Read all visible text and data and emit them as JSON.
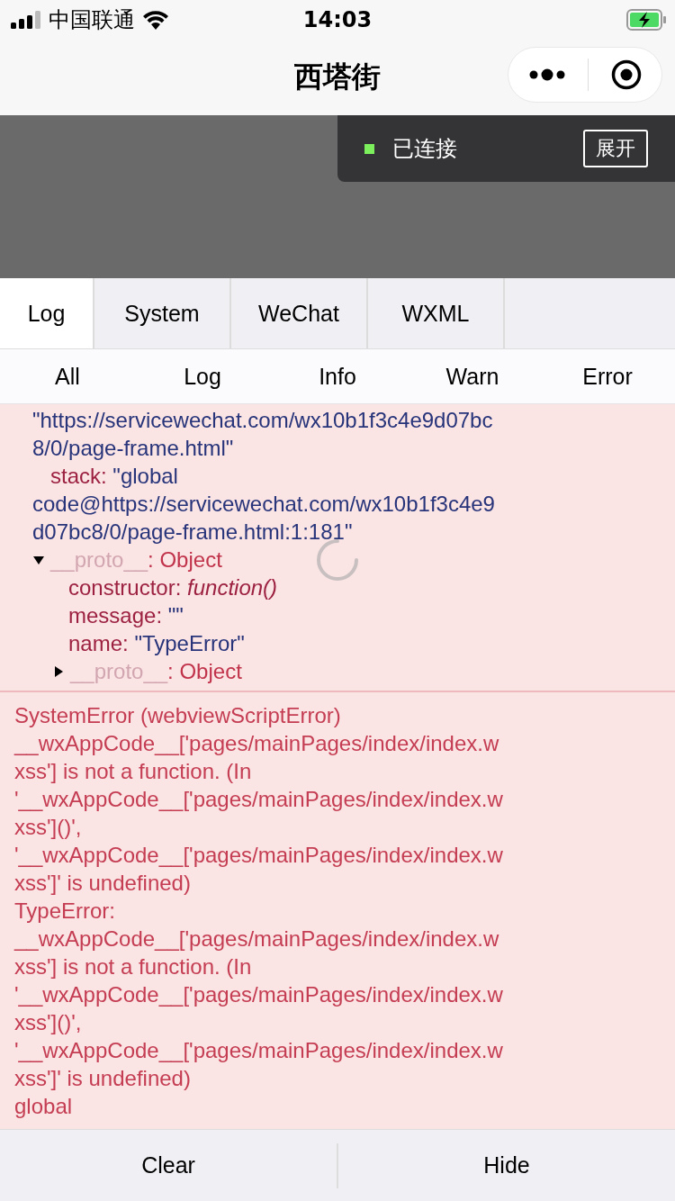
{
  "status_bar": {
    "carrier": "中国联通",
    "time": "14:03"
  },
  "nav": {
    "title": "西塔街"
  },
  "connection": {
    "status": "已连接",
    "connected": true,
    "button": "展开"
  },
  "tabs": [
    {
      "label": "Log",
      "selected": true
    },
    {
      "label": "System",
      "selected": false
    },
    {
      "label": "WeChat",
      "selected": false
    },
    {
      "label": "WXML",
      "selected": false
    }
  ],
  "filters": [
    "All",
    "Log",
    "Info",
    "Warn",
    "Error"
  ],
  "log": [
    {
      "kind": "object",
      "rows": [
        {
          "kind": "text",
          "lines": [
            "\"https://servicewechat.com/wx10b1f3c4e9d07bc",
            "8/0/page-frame.html\""
          ]
        },
        {
          "kind": "prop",
          "key": "stack:",
          "value": "\"global",
          "more": [
            "code@https://servicewechat.com/wx10b1f3c4e9",
            "d07bc8/0/page-frame.html:1:181\""
          ]
        },
        {
          "kind": "node",
          "key": "__proto__",
          "value": ": Object",
          "expanded": true,
          "children": [
            {
              "kind": "prop",
              "key": "constructor:",
              "value": "function()",
              "italic": true
            },
            {
              "kind": "prop",
              "key": "message:",
              "value": "\"\""
            },
            {
              "kind": "prop",
              "key": "name:",
              "value": "\"TypeError\""
            },
            {
              "kind": "node",
              "key": "__proto__",
              "value": ": Object",
              "expanded": false
            }
          ]
        }
      ]
    },
    {
      "kind": "error",
      "lines": [
        "SystemError (webviewScriptError)",
        "__wxAppCode__['pages/mainPages/index/index.w",
        "xss'] is not a function. (In",
        "'__wxAppCode__['pages/mainPages/index/index.w",
        "xss']()',",
        "'__wxAppCode__['pages/mainPages/index/index.w",
        "xss']' is undefined)",
        "TypeError:",
        "__wxAppCode__['pages/mainPages/index/index.w",
        "xss'] is not a function. (In",
        "'__wxAppCode__['pages/mainPages/index/index.w",
        "xss']()',",
        "'__wxAppCode__['pages/mainPages/index/index.w",
        "xss']' is undefined)",
        "global"
      ]
    }
  ],
  "actions": [
    "Clear",
    "Hide"
  ]
}
